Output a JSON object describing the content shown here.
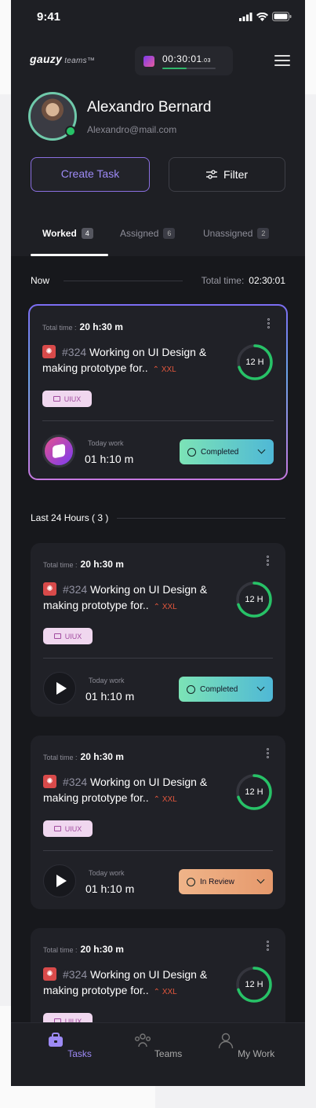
{
  "status_bar": {
    "time": "9:41"
  },
  "header": {
    "logo": "gauzy",
    "logo_suffix": "teams™",
    "timer_value": "00:30:01",
    "timer_fraction": ".03",
    "timer_progress": 0.45
  },
  "profile": {
    "name": "Alexandro Bernard",
    "email": "Alexandro@mail.com"
  },
  "actions": {
    "create_task": "Create Task",
    "filter": "Filter"
  },
  "tabs": [
    {
      "label": "Worked",
      "count": "4"
    },
    {
      "label": "Assigned",
      "count": "6"
    },
    {
      "label": "Unassigned",
      "count": "2"
    }
  ],
  "now_section": {
    "label": "Now",
    "total_label": "Total time:",
    "total_value": "02:30:01"
  },
  "last24": {
    "label": "Last 24 Hours ( 3 )"
  },
  "cards": [
    {
      "total_label": "Total time :",
      "total_value": "20 h:30 m",
      "task_number": "#324",
      "title": "Working on UI Design & making prototype for..",
      "priority": "XXL",
      "estimate": "12 H",
      "progress": 0.7,
      "tag": "UIUX",
      "today_label": "Today work",
      "today_value": "01 h:10 m",
      "status": "Completed"
    },
    {
      "total_label": "Total time :",
      "total_value": "20 h:30 m",
      "task_number": "#324",
      "title": "Working on UI Design & making prototype for..",
      "priority": "XXL",
      "estimate": "12 H",
      "progress": 0.7,
      "tag": "UIUX",
      "today_label": "Today work",
      "today_value": "01 h:10 m",
      "status": "Completed"
    },
    {
      "total_label": "Total time :",
      "total_value": "20 h:30 m",
      "task_number": "#324",
      "title": "Working on UI Design & making prototype for..",
      "priority": "XXL",
      "estimate": "12 H",
      "progress": 0.7,
      "tag": "UIUX",
      "today_label": "Today work",
      "today_value": "01 h:10 m",
      "status": "In Review"
    },
    {
      "total_label": "Total time :",
      "total_value": "20 h:30 m",
      "task_number": "#324",
      "title": "Working on UI Design & making prototype for..",
      "priority": "XXL",
      "estimate": "12 H",
      "progress": 0.7,
      "tag": "UIUX"
    }
  ],
  "bottom_nav": [
    {
      "label": "Tasks",
      "icon": "briefcase-icon"
    },
    {
      "label": "Teams",
      "icon": "people-icon"
    },
    {
      "label": "My Work",
      "icon": "user-icon"
    }
  ],
  "colors": {
    "accent": "#9d8af5",
    "ring": "#27c267",
    "completed": "#5fd0c3",
    "review": "#ebaa7b",
    "bug": "#d84a4a"
  }
}
